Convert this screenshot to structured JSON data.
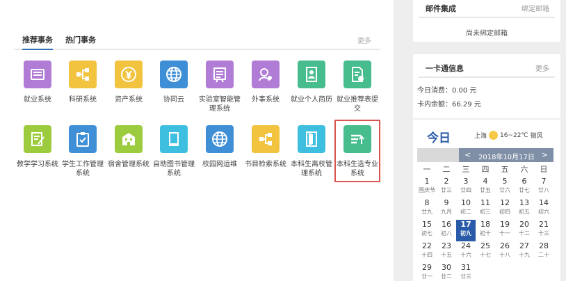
{
  "tabs": {
    "recommended": "推荐事务",
    "popular": "热门事务",
    "more": "更多"
  },
  "apps": [
    {
      "label": "就业系统",
      "color": "#b07cd6",
      "icon": "id-card-icon"
    },
    {
      "label": "科研系统",
      "color": "#f2c33f",
      "icon": "network-icon"
    },
    {
      "label": "资产系统",
      "color": "#f2c33f",
      "icon": "yen-icon"
    },
    {
      "label": "协同云",
      "color": "#3e8fd6",
      "icon": "globe-icon"
    },
    {
      "label": "实验室智能管理系统",
      "color": "#b07cd6",
      "icon": "lab-board-icon"
    },
    {
      "label": "外事系统",
      "color": "#b07cd6",
      "icon": "person-badge-icon"
    },
    {
      "label": "就业个人简历",
      "color": "#47bd8e",
      "icon": "resume-icon"
    },
    {
      "label": "就业推荐表提交",
      "color": "#47bd8e",
      "icon": "document-check-icon"
    },
    {
      "label": "教学学习系统",
      "color": "#9ccc3d",
      "icon": "edit-note-icon"
    },
    {
      "label": "学生工作管理系统",
      "color": "#3e8fd6",
      "icon": "clipboard-check-icon"
    },
    {
      "label": "宿舍管理系统",
      "color": "#9ccc3d",
      "icon": "building-icon"
    },
    {
      "label": "自助图书管理系统",
      "color": "#3ebfe0",
      "icon": "book-icon"
    },
    {
      "label": "校园网运维",
      "color": "#3e8fd6",
      "icon": "globe-icon"
    },
    {
      "label": "书目检索系统",
      "color": "#f2c33f",
      "icon": "network-icon"
    },
    {
      "label": "本科生离校管理系统",
      "color": "#3ebfe0",
      "icon": "door-icon"
    },
    {
      "label": "本科生选专业系统",
      "color": "#47bd8e",
      "icon": "sort-up-icon"
    }
  ],
  "mail": {
    "title": "邮件集成",
    "bind_link": "绑定邮箱",
    "status": "尚未绑定邮箱"
  },
  "card_info": {
    "title": "一卡通信息",
    "more": "更多",
    "today_spend": "今日消费：0.00 元",
    "balance": "卡内余额：66.29 元"
  },
  "calendar": {
    "today_label": "今日",
    "city": "上海",
    "temp": "16~22℃",
    "wind": "微风",
    "month_title": "2018年10月17日",
    "prev": "<",
    "next": ">",
    "weekdays": [
      "一",
      "二",
      "三",
      "四",
      "五",
      "六",
      "日"
    ],
    "weeks": [
      [
        {
          "d": "1",
          "l": "国庆节"
        },
        {
          "d": "2",
          "l": "廿三"
        },
        {
          "d": "3",
          "l": "廿四"
        },
        {
          "d": "4",
          "l": "廿五"
        },
        {
          "d": "5",
          "l": "廿六"
        },
        {
          "d": "6",
          "l": "廿七"
        },
        {
          "d": "7",
          "l": "廿八"
        }
      ],
      [
        {
          "d": "8",
          "l": "廿九"
        },
        {
          "d": "9",
          "l": "九月"
        },
        {
          "d": "10",
          "l": "初二"
        },
        {
          "d": "11",
          "l": "初三"
        },
        {
          "d": "12",
          "l": "初四"
        },
        {
          "d": "13",
          "l": "初五"
        },
        {
          "d": "14",
          "l": "初六"
        }
      ],
      [
        {
          "d": "15",
          "l": "初七"
        },
        {
          "d": "16",
          "l": "初八"
        },
        {
          "d": "17",
          "l": "初九",
          "sel": true
        },
        {
          "d": "18",
          "l": "初十"
        },
        {
          "d": "19",
          "l": "十一"
        },
        {
          "d": "20",
          "l": "十二"
        },
        {
          "d": "21",
          "l": "十三"
        }
      ],
      [
        {
          "d": "22",
          "l": "十四"
        },
        {
          "d": "23",
          "l": "十五"
        },
        {
          "d": "24",
          "l": "十六"
        },
        {
          "d": "25",
          "l": "十七"
        },
        {
          "d": "26",
          "l": "十八"
        },
        {
          "d": "27",
          "l": "十九"
        },
        {
          "d": "28",
          "l": "二十"
        }
      ],
      [
        {
          "d": "29",
          "l": "廿一"
        },
        {
          "d": "30",
          "l": "廿二"
        },
        {
          "d": "31",
          "l": "廿三"
        },
        {
          "d": "",
          "l": ""
        },
        {
          "d": "",
          "l": ""
        },
        {
          "d": "",
          "l": ""
        },
        {
          "d": "",
          "l": ""
        }
      ]
    ]
  }
}
